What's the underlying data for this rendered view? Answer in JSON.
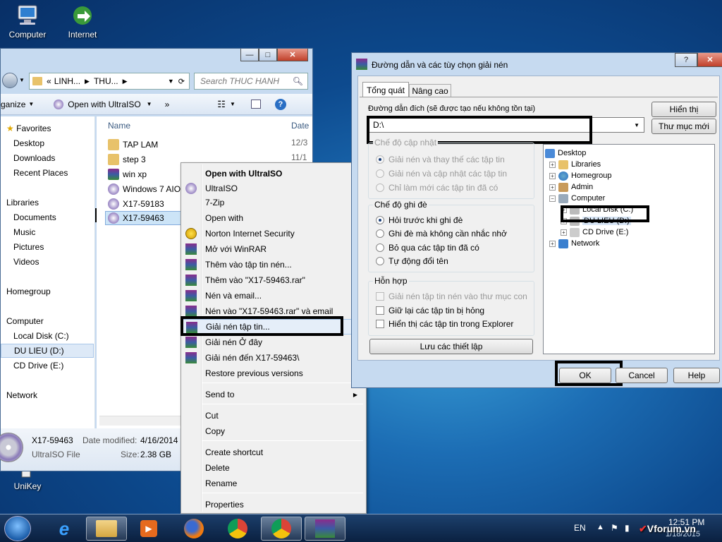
{
  "desktop": {
    "icons": [
      {
        "label": "Computer",
        "icon": "computer-icon"
      },
      {
        "label": "Internet Downlo...",
        "icon": "idm-icon"
      }
    ],
    "unikey_label": "UniKey"
  },
  "explorer": {
    "breadcrumb": [
      "«",
      "LINH...",
      "THU..."
    ],
    "search_placeholder": "Search THUC HANH",
    "toolbar": {
      "organize": "ganize",
      "open_with": "Open with UltraISO",
      "more": "»"
    },
    "nav": {
      "favorites": "Favorites",
      "desktop": "Desktop",
      "downloads": "Downloads",
      "recent": "Recent Places",
      "libraries": "Libraries",
      "documents": "Documents",
      "music": "Music",
      "pictures": "Pictures",
      "videos": "Videos",
      "homegroup": "Homegroup",
      "computer": "Computer",
      "local_disk": "Local Disk (C:)",
      "du_lieu": "DU LIEU (D:)",
      "cd_drive": "CD Drive (E:)",
      "network": "Network"
    },
    "columns": {
      "name": "Name",
      "date": "Date"
    },
    "files": [
      {
        "name": "TAP LAM",
        "date": "12/3"
      },
      {
        "name": "step 3",
        "date": "11/1"
      },
      {
        "name": "win xp",
        "date": ""
      },
      {
        "name": "Windows 7  AIO",
        "date": ""
      },
      {
        "name": "X17-59183",
        "date": ""
      },
      {
        "name": "X17-59463",
        "date": ""
      }
    ],
    "details": {
      "name": "X17-59463",
      "type": "UltraISO File",
      "date_label": "Date modified:",
      "date_value": "4/16/2014 9",
      "size_label": "Size:",
      "size_value": "2.38 GB"
    }
  },
  "context_menu": {
    "items": [
      {
        "label": "Open with UltraISO",
        "bold": true
      },
      {
        "label": "UltraISO",
        "submenu": true
      },
      {
        "label": "7-Zip",
        "submenu": true
      },
      {
        "label": "Open with",
        "submenu": true
      },
      {
        "label": "Norton Internet Security",
        "submenu": true
      },
      {
        "label": "Mở với WinRAR"
      },
      {
        "label": "Thêm vào tập tin nén..."
      },
      {
        "label": "Thêm vào \"X17-59463.rar\""
      },
      {
        "label": "Nén và email..."
      },
      {
        "label": "Nén vào \"X17-59463.rar\" và email"
      },
      {
        "label": "Giải nén tập tin..."
      },
      {
        "label": "Giải nén Ở đây"
      },
      {
        "label": "Giải nén đến X17-59463\\"
      },
      {
        "label": "Restore previous versions"
      },
      {
        "label": "Send to",
        "submenu": true
      },
      {
        "label": "Cut"
      },
      {
        "label": "Copy"
      },
      {
        "label": "Create shortcut"
      },
      {
        "label": "Delete"
      },
      {
        "label": "Rename"
      },
      {
        "label": "Properties"
      }
    ]
  },
  "dialog": {
    "title": "Đường dẫn và các tùy chọn giải nén",
    "help_btn": "?",
    "tabs": [
      "Tổng quát",
      "Nâng cao"
    ],
    "dest_label": "Đường dẫn đích (sẽ được tạo nếu không tồn tại)",
    "dest_value": "D:\\",
    "btn_show": "Hiển thị",
    "btn_new_folder": "Thư mục mới",
    "update_group": "Chế độ cập nhật",
    "update_options": [
      "Giải nén và thay thế các tập tin",
      "Giải nén và cập nhật các tập tin",
      "Chỉ làm mới các tập tin đã có"
    ],
    "overwrite_group": "Chế độ ghi đè",
    "overwrite_options": [
      "Hỏi trước khi ghi đè",
      "Ghi đè mà không cần nhắc nhở",
      "Bỏ qua các tập tin đã có",
      "Tự động đổi tên"
    ],
    "misc_group": "Hỗn hợp",
    "misc_options": [
      "Giải nén tập tin nén vào thư mục con",
      "Giữ lại các tập tin bị hỏng",
      "Hiển thị các tập tin trong Explorer"
    ],
    "save_settings": "Lưu các thiết lập",
    "tree": [
      "Desktop",
      "Libraries",
      "Homegroup",
      "Admin",
      "Computer",
      "Local Disk (C:)",
      "DU LIEU (D:)",
      "CD Drive (E:)",
      "Network"
    ],
    "ok": "OK",
    "cancel": "Cancel",
    "help": "Help"
  },
  "taskbar": {
    "lang": "EN",
    "time": "12:51 PM",
    "date": "1/18/2015",
    "watermark": "Vforum.vn"
  }
}
